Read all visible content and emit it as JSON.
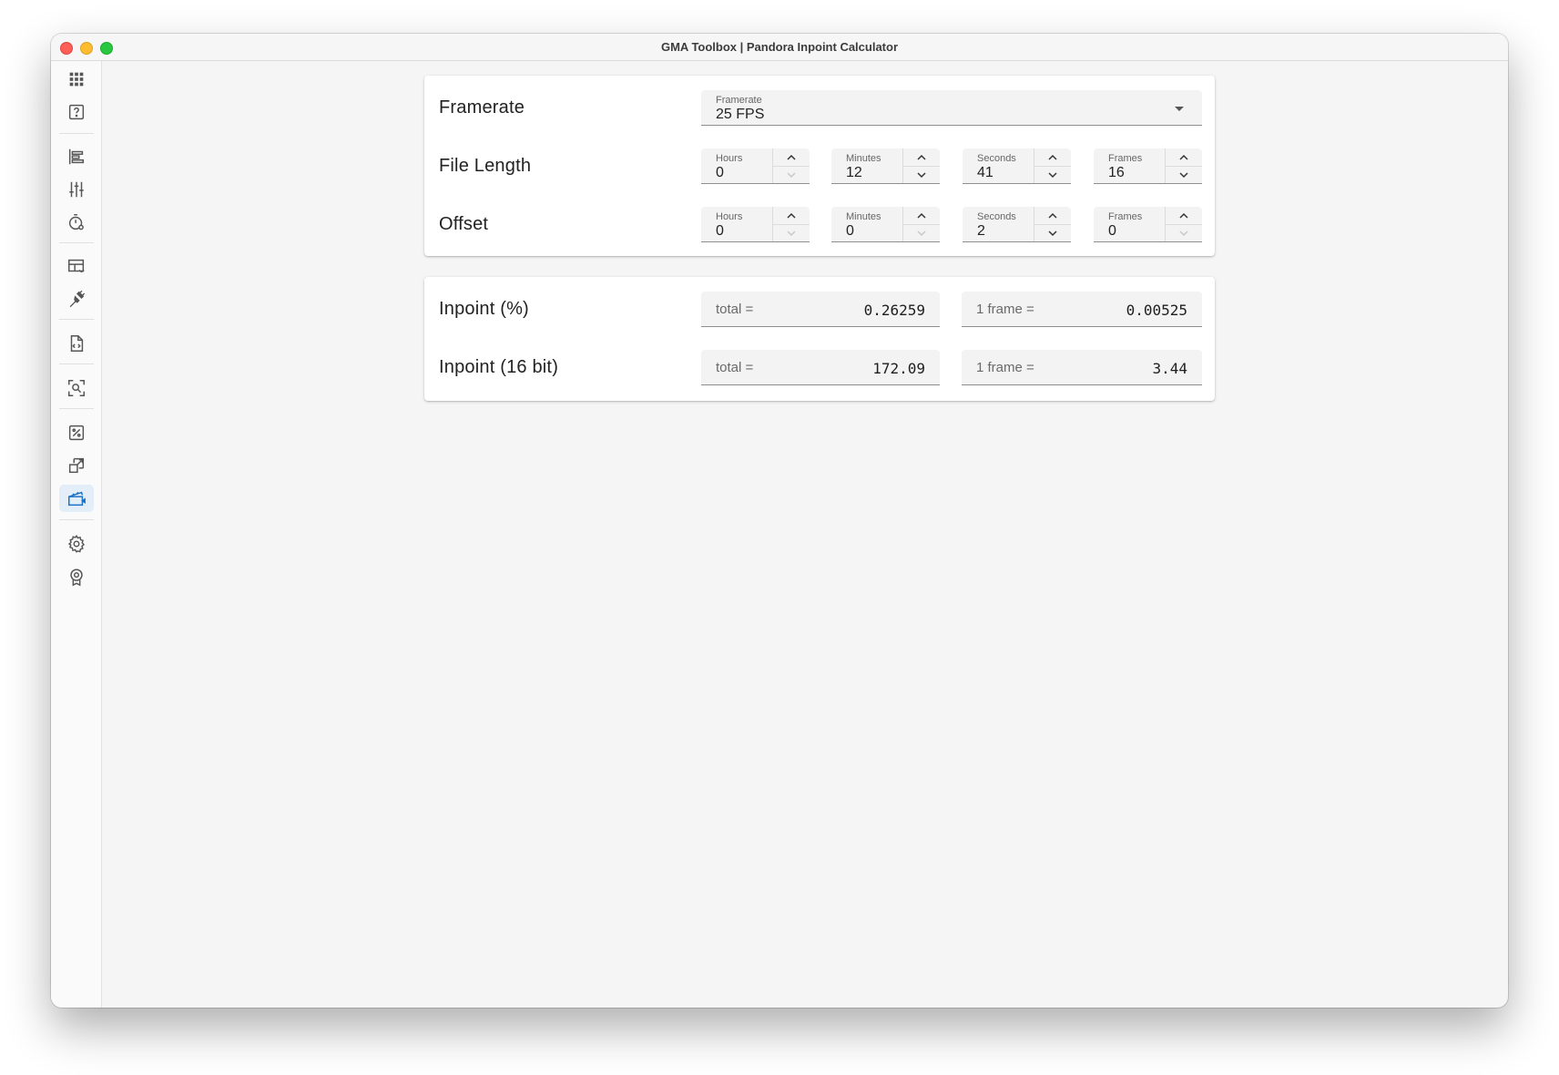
{
  "window": {
    "title": "GMA Toolbox | Pandora Inpoint Calculator"
  },
  "sidebar": {
    "items": [
      {
        "icon": "apps-grid-icon"
      },
      {
        "icon": "help-icon"
      },
      {
        "icon": "align-left-icon"
      },
      {
        "icon": "sliders-icon"
      },
      {
        "icon": "timer-icon"
      },
      {
        "icon": "table-icon"
      },
      {
        "icon": "plug-icon"
      },
      {
        "icon": "code-file-icon"
      },
      {
        "icon": "search-scan-icon"
      },
      {
        "icon": "percent-icon"
      },
      {
        "icon": "resize-icon"
      },
      {
        "icon": "video-clapper-icon",
        "active": true
      },
      {
        "icon": "gear-icon"
      },
      {
        "icon": "badge-icon"
      }
    ],
    "active_color": "#1a73c8"
  },
  "settings": {
    "framerate": {
      "label": "Framerate",
      "field_label": "Framerate",
      "value": "25 FPS"
    },
    "file_length": {
      "label": "File Length",
      "hours": {
        "label": "Hours",
        "value": "0"
      },
      "minutes": {
        "label": "Minutes",
        "value": "12"
      },
      "seconds": {
        "label": "Seconds",
        "value": "41"
      },
      "frames": {
        "label": "Frames",
        "value": "16"
      }
    },
    "offset": {
      "label": "Offset",
      "hours": {
        "label": "Hours",
        "value": "0"
      },
      "minutes": {
        "label": "Minutes",
        "value": "0"
      },
      "seconds": {
        "label": "Seconds",
        "value": "2"
      },
      "frames": {
        "label": "Frames",
        "value": "0"
      }
    }
  },
  "results": {
    "percent": {
      "label": "Inpoint (%)",
      "total_prefix": "total =",
      "total": "0.26259",
      "frame_prefix": "1 frame =",
      "frame": "0.00525"
    },
    "bit16": {
      "label": "Inpoint (16 bit)",
      "total_prefix": "total =",
      "total": "172.09",
      "frame_prefix": "1 frame =",
      "frame": "3.44"
    }
  }
}
